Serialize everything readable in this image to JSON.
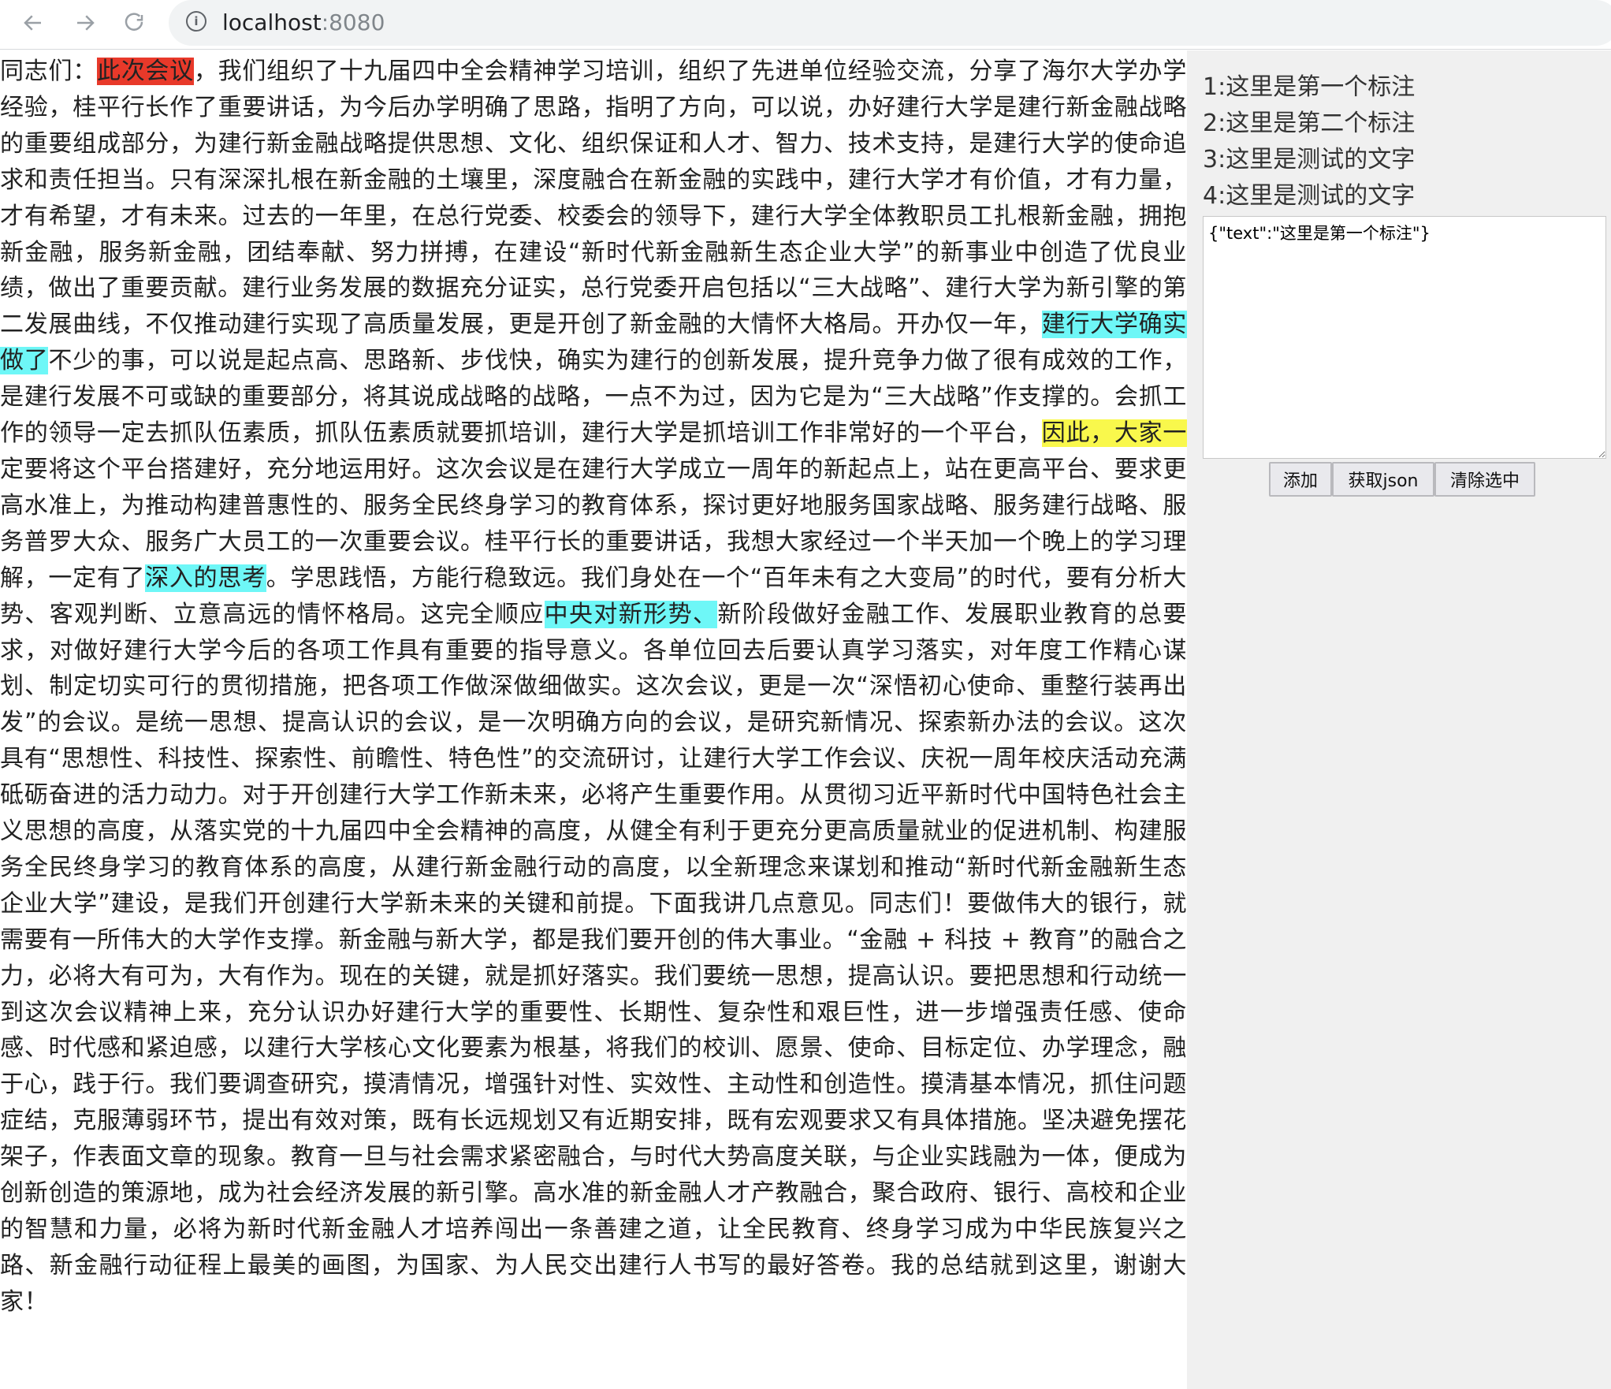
{
  "browser": {
    "url_host": "localhost",
    "url_port": ":8080"
  },
  "article": {
    "segments": [
      {
        "text": "同志们：",
        "hl": ""
      },
      {
        "text": "此次会议",
        "hl": "red"
      },
      {
        "text": "，我们组织了十九届四中全会精神学习培训，组织了先进单位经验交流，分享了海尔大学办学经验，桂平行长作了重要讲话，为今后办学明确了思路，指明了方向，可以说，办好建行大学是建行新金融战略的重要组成部分，为建行新金融战略提供思想、文化、组织保证和人才、智力、技术支持，是建行大学的使命追求和责任担当。只有深深扎根在新金融的土壤里，深度融合在新金融的实践中，建行大学才有价值，才有力量，才有希望，才有未来。过去的一年里，在总行党委、校委会的领导下，建行大学全体教职员工扎根新金融，拥抱新金融，服务新金融，团结奉献、努力拼搏，在建设“新时代新金融新生态企业大学”的新事业中创造了优良业绩，做出了重要贡献。建行业务发展的数据充分证实，总行党委开启包括以“三大战略”、建行大学为新引擎的第二发展曲线，不仅推动建行实现了高质量发展，更是开创了新金融的大情怀大格局。开办仅一年，",
        "hl": ""
      },
      {
        "text": "建行大学确实做了",
        "hl": "cyan"
      },
      {
        "text": "不少的事，可以说是起点高、思路新、步伐快，确实为建行的创新发展，提升竞争力做了很有成效的工作，是建行发展不可或缺的重要部分，将其说成战略的战略，一点不为过，因为它是为“三大战略”作支撑的。会抓工作的领导一定去抓队伍素质，抓队伍素质就要抓培训，建行大学是抓培训工作非常好的一个平台，",
        "hl": ""
      },
      {
        "text": "因此，大家一",
        "hl": "yellow"
      },
      {
        "text": "定要将这个平台搭建好，充分地运用好。这次会议是在建行大学成立一周年的新起点上，站在更高平台、要求更高水准上，为推动构建普惠性的、服务全民终身学习的教育体系，探讨更好地服务国家战略、服务建行战略、服务普罗大众、服务广大员工的一次重要会议。桂平行长的重要讲话，我想大家经过一个半天加一个晚上的学习理解，一定有了",
        "hl": ""
      },
      {
        "text": "深入的思考",
        "hl": "cyan"
      },
      {
        "text": "。学思践悟，方能行稳致远。我们身处在一个“百年未有之大变局”的时代，要有分析大势、客观判断、立意高远的情怀格局。这完全顺应",
        "hl": ""
      },
      {
        "text": "中央对新形势、",
        "hl": "cyan"
      },
      {
        "text": "新阶段做好金融工作、发展职业教育的总要求，对做好建行大学今后的各项工作具有重要的指导意义。各单位回去后要认真学习落实，对年度工作精心谋划、制定切实可行的贯彻措施，把各项工作做深做细做实。这次会议，更是一次“深悟初心使命、重整行装再出发”的会议。是统一思想、提高认识的会议，是一次明确方向的会议，是研究新情况、探索新办法的会议。这次具有“思想性、科技性、探索性、前瞻性、特色性”的交流研讨，让建行大学工作会议、庆祝一周年校庆活动充满砥砺奋进的活力动力。对于开创建行大学工作新未来，必将产生重要作用。从贯彻习近平新时代中国特色社会主义思想的高度，从落实党的十九届四中全会精神的高度，从健全有利于更充分更高质量就业的促进机制、构建服务全民终身学习的教育体系的高度，从建行新金融行动的高度，以全新理念来谋划和推动“新时代新金融新生态企业大学”建设，是我们开创建行大学新未来的关键和前提。下面我讲几点意见。同志们！要做伟大的银行，就需要有一所伟大的大学作支撑。新金融与新大学，都是我们要开创的伟大事业。“金融 + 科技 + 教育”的融合之力，必将大有可为，大有作为。现在的关键，就是抓好落实。我们要统一思想，提高认识。要把思想和行动统一到这次会议精神上来，充分认识办好建行大学的重要性、长期性、复杂性和艰巨性，进一步增强责任感、使命感、时代感和紧迫感，以建行大学核心文化要素为根基，将我们的校训、愿景、使命、目标定位、办学理念，融于心，践于行。我们要调查研究，摸清情况，增强针对性、实效性、主动性和创造性。摸清基本情况，抓住问题症结，克服薄弱环节，提出有效对策，既有长远规划又有近期安排，既有宏观要求又有具体措施。坚决避免摆花架子，作表面文章的现象。教育一旦与社会需求紧密融合，与时代大势高度关联，与企业实践融为一体，便成为创新创造的策源地，成为社会经济发展的新引擎。高水准的新金融人才产教融合，聚合政府、银行、高校和企业的智慧和力量，必将为新时代新金融人才培养闯出一条善建之道，让全民教育、终身学习成为中华民族复兴之路、新金融行动征程上最美的画图，为国家、为人民交出建行人书写的最好答卷。我的总结就到这里，谢谢大家！",
        "hl": ""
      }
    ]
  },
  "panel": {
    "annotations": [
      "1:这里是第一个标注",
      "2:这里是第二个标注",
      "3:这里是测试的文字",
      "4:这里是测试的文字"
    ],
    "json_output": "{\"text\":\"这里是第一个标注\"}",
    "buttons": {
      "add": "添加",
      "get_json": "获取json",
      "clear": "清除选中"
    }
  },
  "colors": {
    "highlight_red": "#e8392a",
    "highlight_cyan": "#6ef7f7",
    "highlight_yellow": "#f9f84c",
    "panel_bg": "#f0f0f0"
  }
}
